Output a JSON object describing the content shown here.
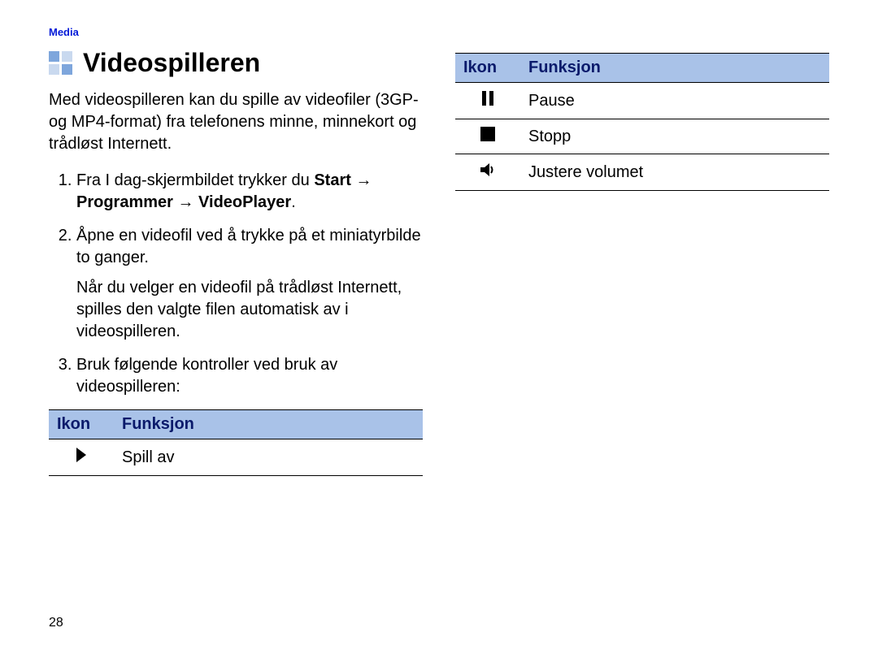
{
  "breadcrumb": "Media",
  "heading": "Videospilleren",
  "intro": "Med videospilleren kan du spille av videofiler (3GP- og MP4-format) fra telefonens minne, minnekort og trådløst Internett.",
  "steps": {
    "s1_pre": "Fra I dag-skjermbildet trykker du ",
    "s1_path": "Start → Programmer → VideoPlayer",
    "s1_post": ".",
    "s2": "Åpne en videofil ved å trykke på et miniatyrbilde to ganger.",
    "s2_note": "Når du velger en videofil på trådløst Internett, spilles den valgte filen automatisk av i videospilleren.",
    "s3": "Bruk følgende kontroller ved bruk av videospilleren:"
  },
  "table_headers": {
    "icon": "Ikon",
    "func": "Funksjon"
  },
  "rows_left": [
    {
      "icon": "play-icon",
      "label": "Spill av"
    }
  ],
  "rows_right": [
    {
      "icon": "pause-icon",
      "label": "Pause"
    },
    {
      "icon": "stop-icon",
      "label": "Stopp"
    },
    {
      "icon": "volume-icon",
      "label": "Justere volumet"
    }
  ],
  "page_number": "28"
}
